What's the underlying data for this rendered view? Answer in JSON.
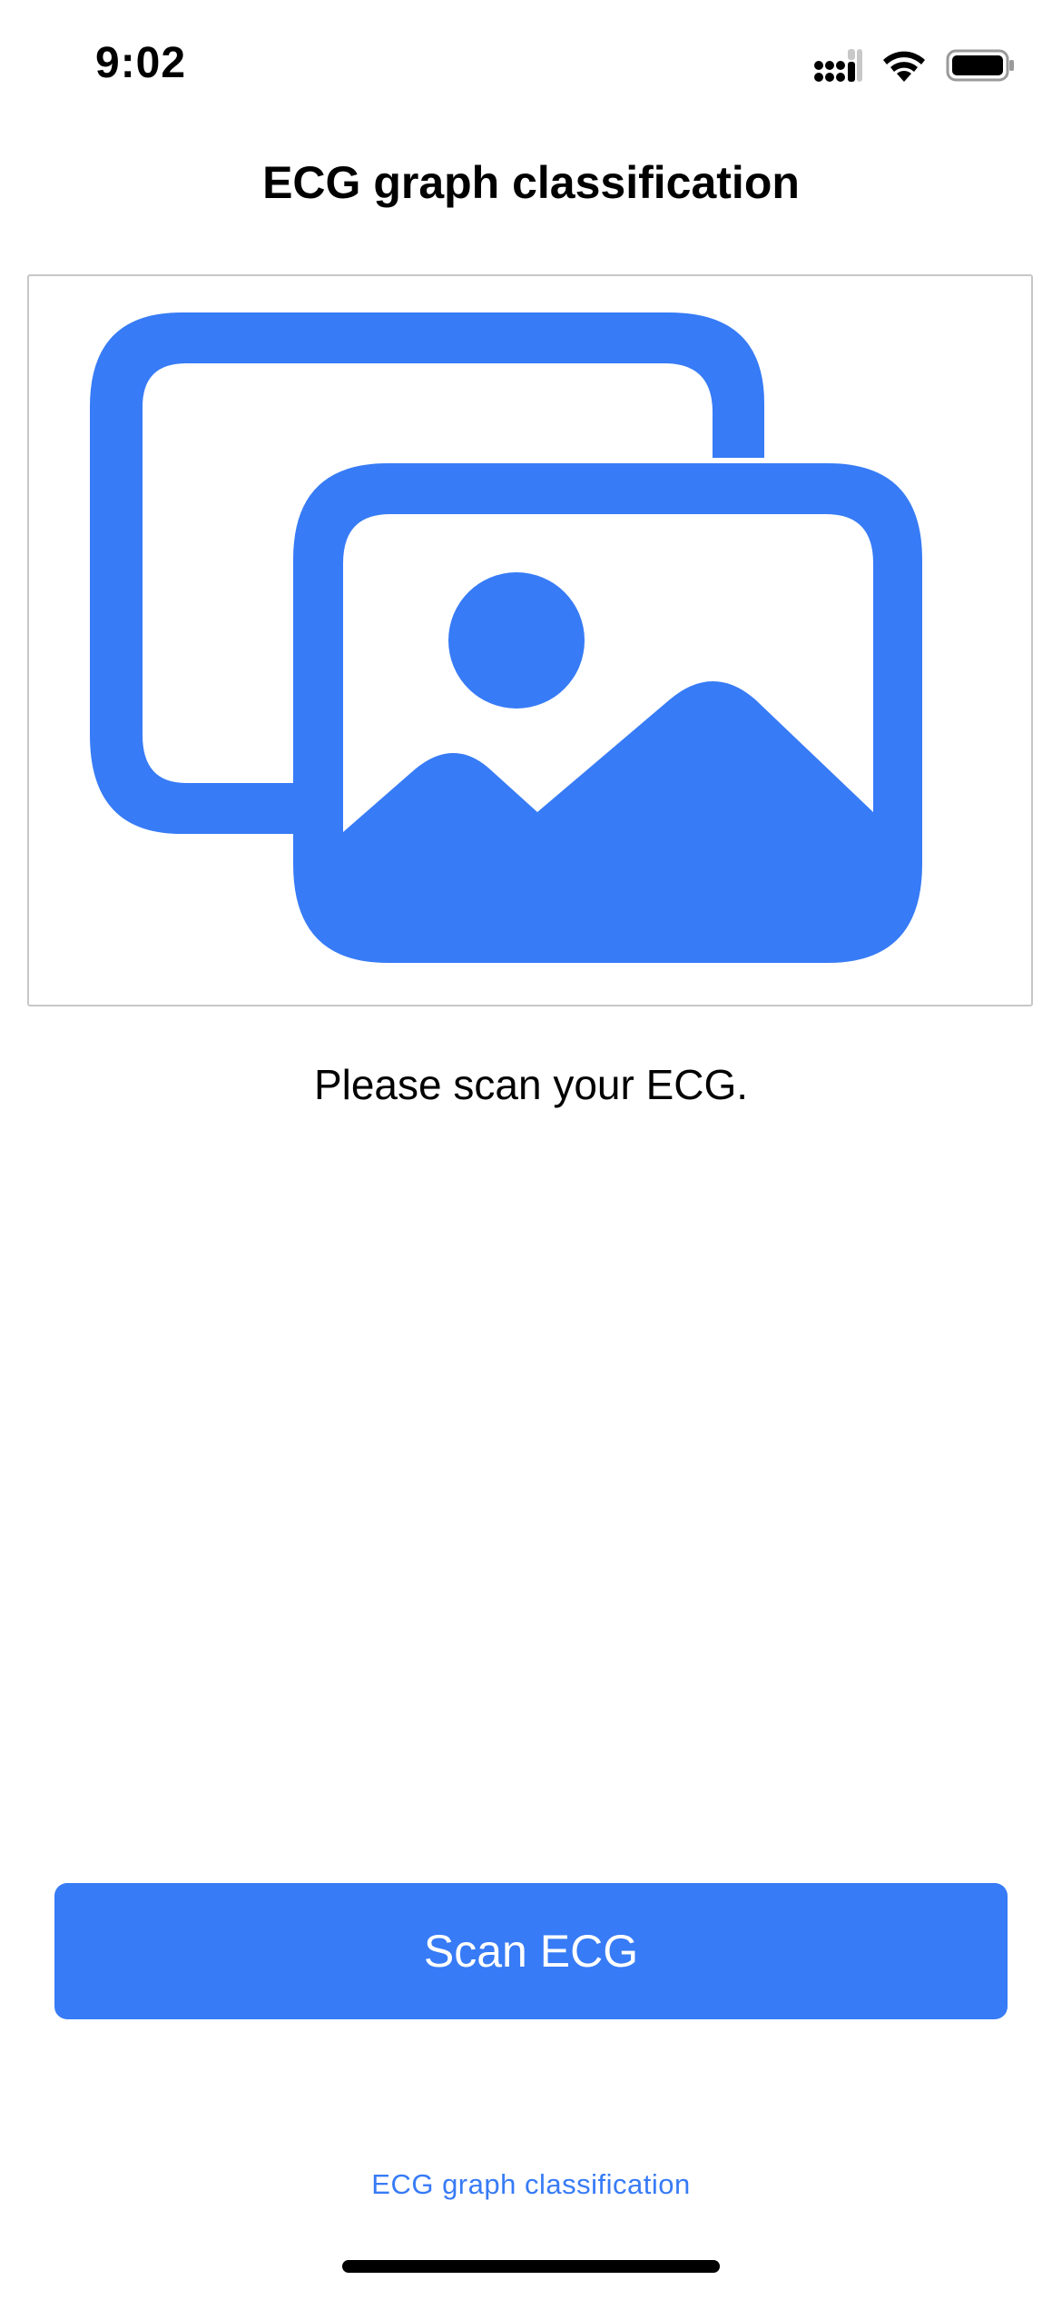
{
  "status_bar": {
    "time": "9:02"
  },
  "header": {
    "title": "ECG graph classification"
  },
  "image_placeholder": {
    "icon": "photo-on-rectangle-icon",
    "color": "#377bf6"
  },
  "main": {
    "prompt": "Please scan your ECG."
  },
  "actions": {
    "scan_label": "Scan ECG"
  },
  "footer": {
    "link_label": "ECG graph classification"
  },
  "colors": {
    "accent": "#377bf6",
    "border": "#c7c7c7"
  }
}
